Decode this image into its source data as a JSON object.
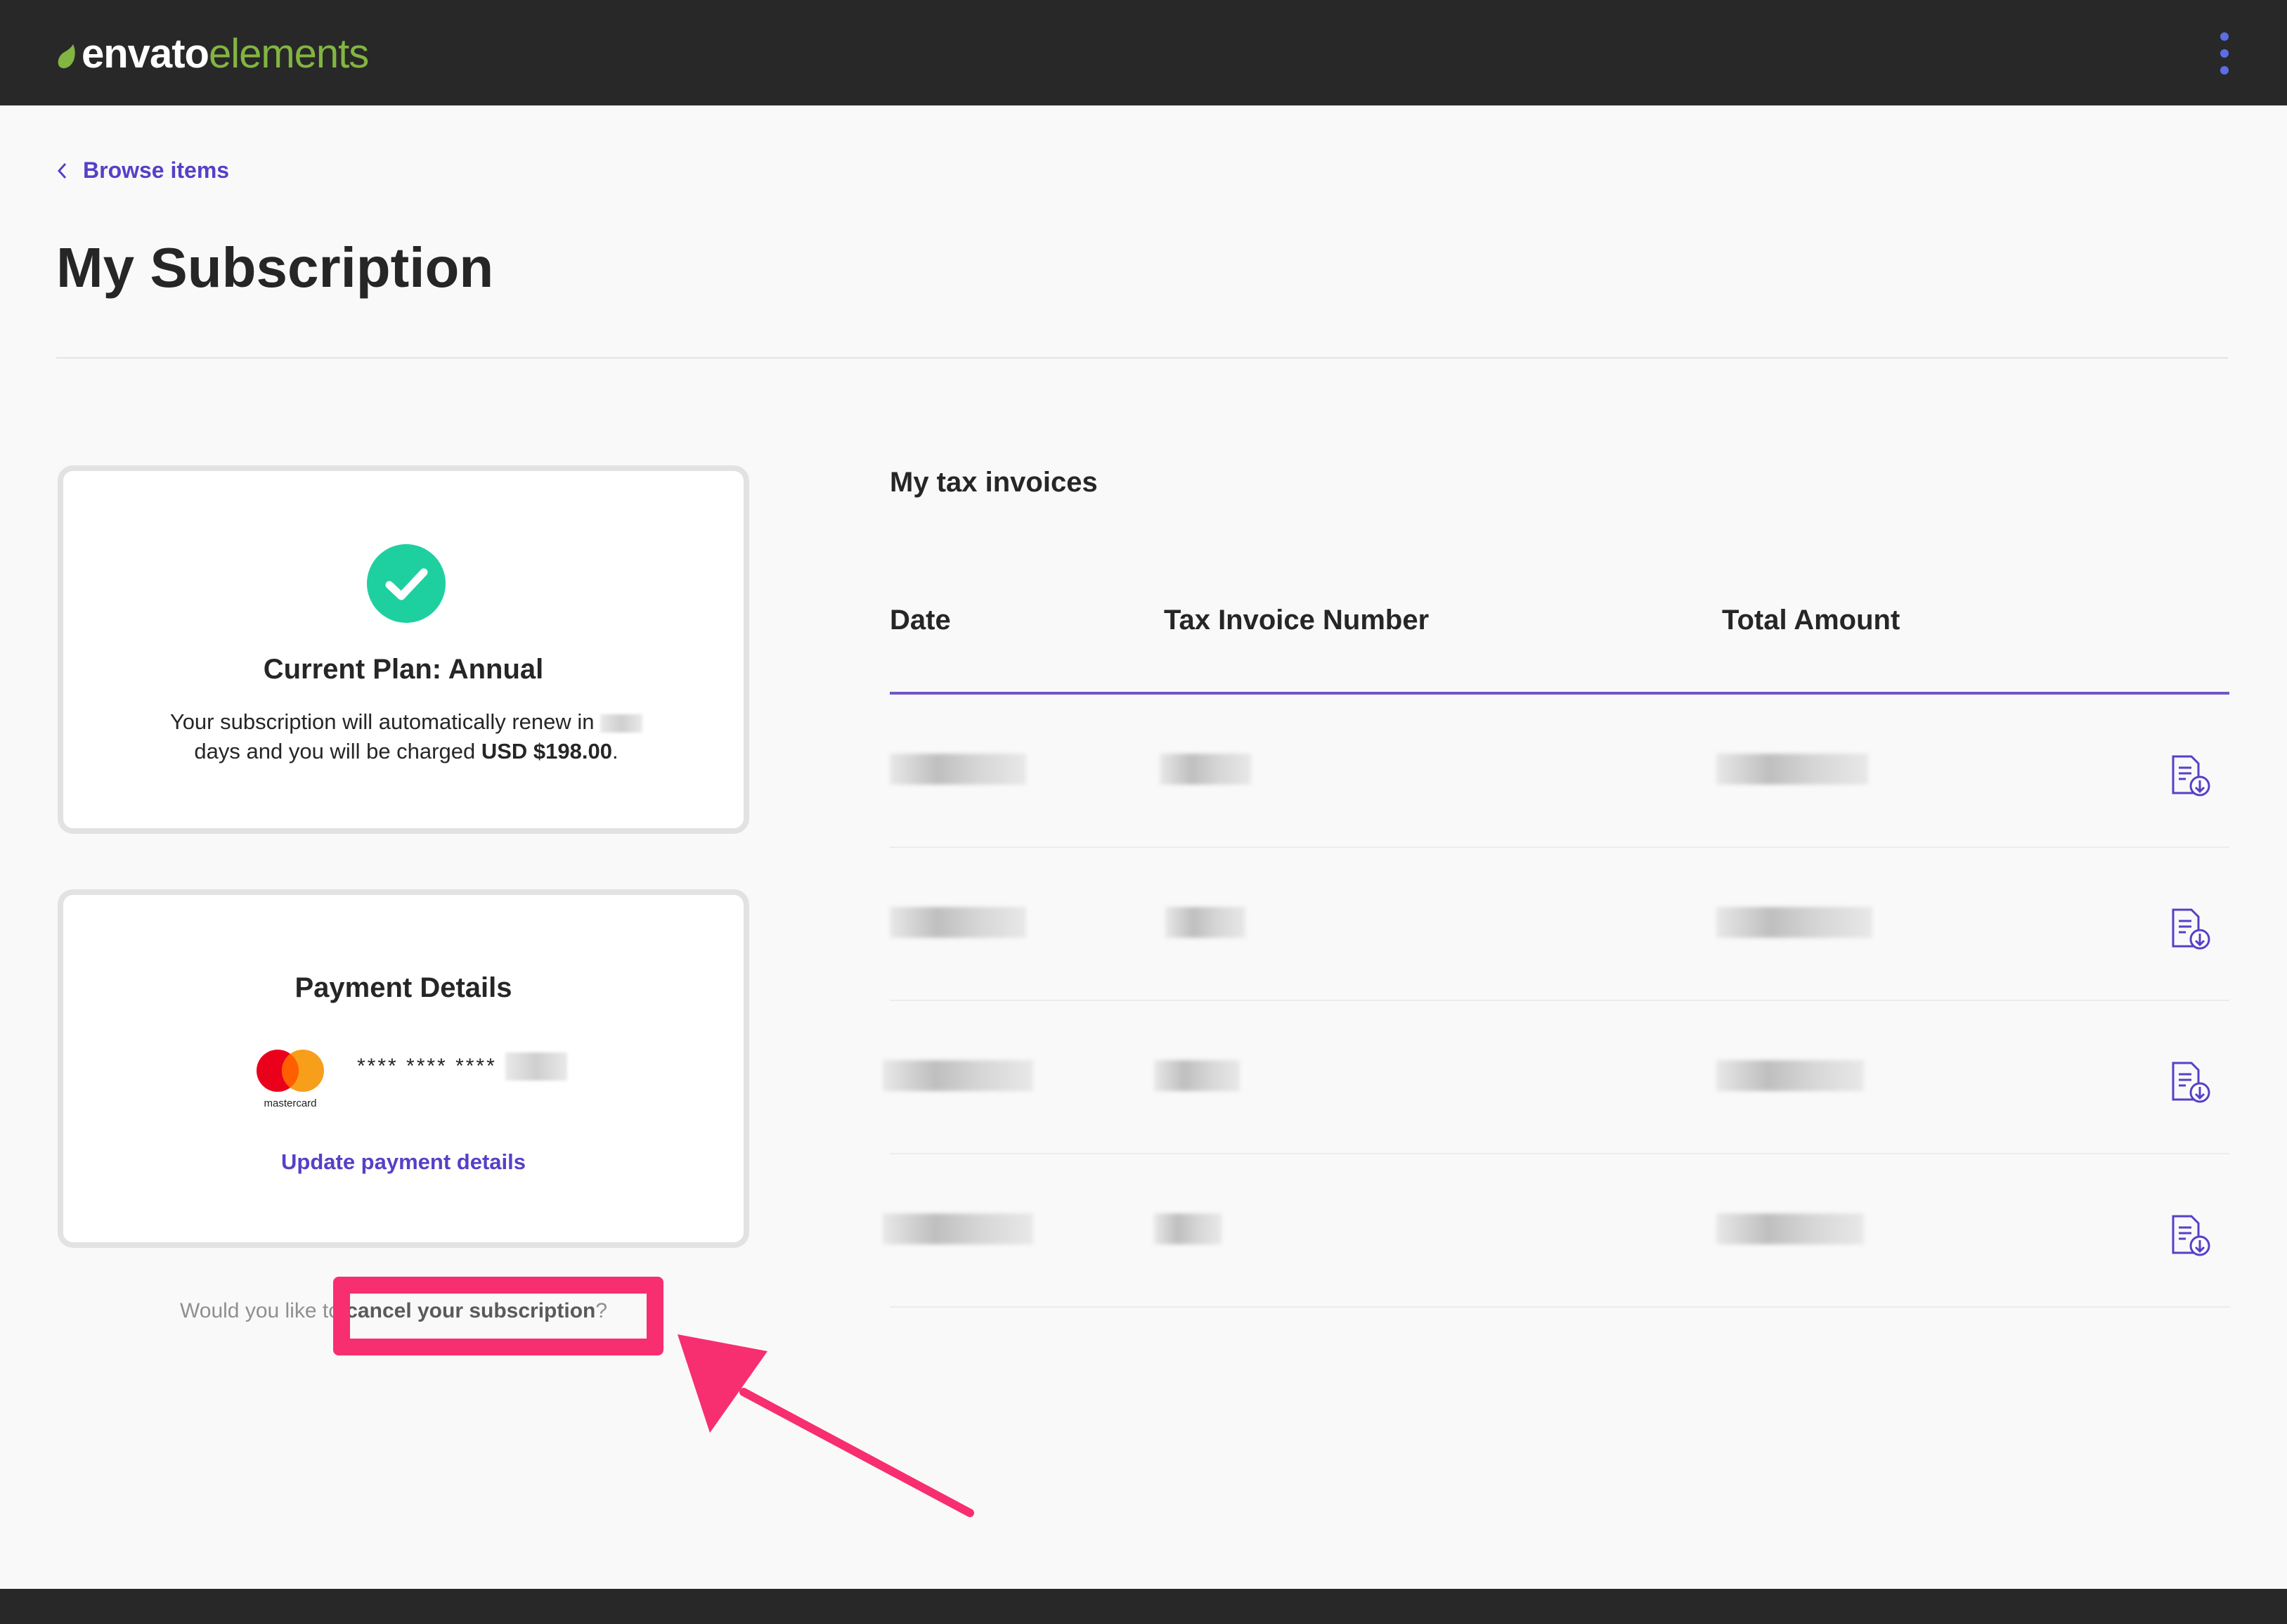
{
  "header": {
    "logo_part1": "envato",
    "logo_part2": "elements",
    "menu_icon": "kebab-menu-icon"
  },
  "nav": {
    "back_label": "Browse items"
  },
  "page": {
    "title": "My Subscription"
  },
  "plan": {
    "title": "Current Plan: Annual",
    "desc_part1": "Your subscription will automatically renew in",
    "desc_part2": "days and you will be charged",
    "amount": "USD $198.00",
    "desc_end": "."
  },
  "payment": {
    "title": "Payment Details",
    "card_brand": "mastercard",
    "card_mask": "**** **** ****",
    "update_label": "Update payment details"
  },
  "cancel": {
    "prefix": "Would you like to",
    "link_label": "cancel your subscription",
    "suffix": "?"
  },
  "invoices": {
    "title": "My tax invoices",
    "columns": [
      "Date",
      "Tax Invoice Number",
      "Total Amount"
    ],
    "rows_count_visible": 4
  },
  "colors": {
    "accent": "#5740c7",
    "success": "#1ed0a0",
    "highlight": "#f72e6f",
    "topbar": "#282828"
  }
}
